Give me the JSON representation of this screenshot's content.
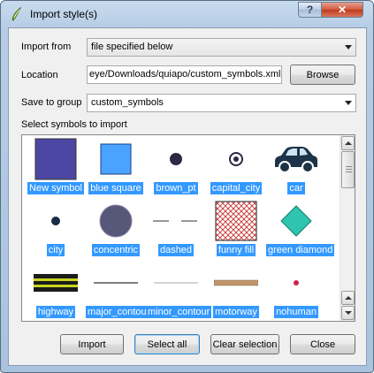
{
  "window": {
    "title": "Import style(s)",
    "help_label": "?",
    "close_label": "✕"
  },
  "form": {
    "import_from_label": "Import from",
    "import_from_value": "file specified below",
    "location_label": "Location",
    "location_value": "eye/Downloads/quiapo/custom_symbols.xml",
    "browse_label": "Browse",
    "save_to_group_label": "Save to group",
    "save_to_group_value": "custom_symbols",
    "select_symbols_label": "Select symbols to import"
  },
  "symbols": [
    {
      "name": "New symbol",
      "icon": "square-fill-icon",
      "color": "#4c47a3"
    },
    {
      "name": "blue square",
      "icon": "square-fill-icon",
      "color": "#4aa3ff"
    },
    {
      "name": "brown_pt",
      "icon": "dot-icon",
      "color": "#2a2a44"
    },
    {
      "name": "capital_city",
      "icon": "ring-dot-icon",
      "color": "#2a2a44"
    },
    {
      "name": "car",
      "icon": "car-icon",
      "color": "#1c3348"
    },
    {
      "name": "city",
      "icon": "dot-icon",
      "color": "#1c2c44"
    },
    {
      "name": "concentric",
      "icon": "circle-icon",
      "color": "#57577a"
    },
    {
      "name": "dashed",
      "icon": "dashed-line-icon",
      "color": "#333333"
    },
    {
      "name": "funny fill",
      "icon": "hatch-fill-icon",
      "color": "#c42828"
    },
    {
      "name": "green diamond",
      "icon": "diamond-icon",
      "color": "#2ec4b0"
    },
    {
      "name": "highway",
      "icon": "highway-line-icon",
      "color": "#c8d41e"
    },
    {
      "name": "major_contour",
      "icon": "line-icon",
      "color": "#555555"
    },
    {
      "name": "minor_contour",
      "icon": "thin-line-icon",
      "color": "#aaaaaa"
    },
    {
      "name": "motorway",
      "icon": "thick-line-icon",
      "color": "#c0956c"
    },
    {
      "name": "nohuman",
      "icon": "small-dot-icon",
      "color": "#d02050"
    }
  ],
  "buttons": {
    "import": "Import",
    "select_all": "Select all",
    "clear_selection": "Clear selection",
    "close": "Close"
  },
  "colors": {
    "selection": "#3399ff",
    "dialog_bg": "#f0f0f0"
  }
}
